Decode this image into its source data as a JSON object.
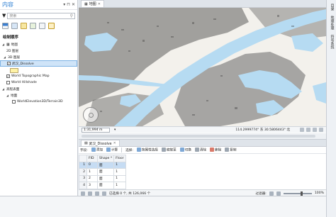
{
  "contents": {
    "title": "内容",
    "search_placeholder": "搜索",
    "drawing_order_label": "绘制顺序",
    "items": [
      {
        "label": "地图",
        "checked": null
      },
      {
        "label": "2D 图层",
        "checked": null
      },
      {
        "label": "3D 图层",
        "checked": null
      },
      {
        "label": "武汉_Dissolve",
        "checked": true,
        "selected": true
      },
      {
        "label": "World Topographic Map",
        "checked": true
      },
      {
        "label": "World Hillshade",
        "checked": false
      },
      {
        "label": "高程表面",
        "checked": null
      },
      {
        "label": "地面",
        "checked": null
      },
      {
        "label": "WorldElevation3D/Terrain3D",
        "checked": false
      }
    ]
  },
  "map": {
    "tab_title": "地图",
    "close_glyph": "✕",
    "scale": "1:31,994 m",
    "coordinates": "114.2999774° 东 30.5806443° 北"
  },
  "right_strip": {
    "tabs": [
      "目录",
      "地理处理",
      "符号系统"
    ]
  },
  "attribute_table": {
    "tab_title": "武汉_Dissolve",
    "toolbar": {
      "field_label": "字段:",
      "add_label": "添加",
      "calculate_label": "计算",
      "selection_label": "选择:",
      "by_attribute_label": "按属性选择",
      "zoom_label": "缩放至",
      "switch_label": "切换",
      "clear_label": "清除",
      "delete_label": "删除",
      "copy_label": "复制"
    },
    "columns": [
      "FID",
      "Shape *",
      "Floor"
    ],
    "rows": [
      {
        "n": "1",
        "fid": "0",
        "shape": "面",
        "floor": "1",
        "selected": true
      },
      {
        "n": "2",
        "fid": "1",
        "shape": "面",
        "floor": "1"
      },
      {
        "n": "3",
        "fid": "2",
        "shape": "面",
        "floor": "1"
      },
      {
        "n": "4",
        "fid": "3",
        "shape": "面",
        "floor": "1"
      },
      {
        "n": "5",
        "fid": "4",
        "shape": "面",
        "floor": "1"
      }
    ],
    "status": {
      "selected_text": "已选择 0 个, 共 126,066 个",
      "filter_label": "过滤器:",
      "zoom_percent": "100%"
    }
  },
  "colors": {
    "accent": "#2d7fd3",
    "water": "#b6dbf2",
    "land": "#f3f1ec",
    "built": "#4f4f4f"
  }
}
